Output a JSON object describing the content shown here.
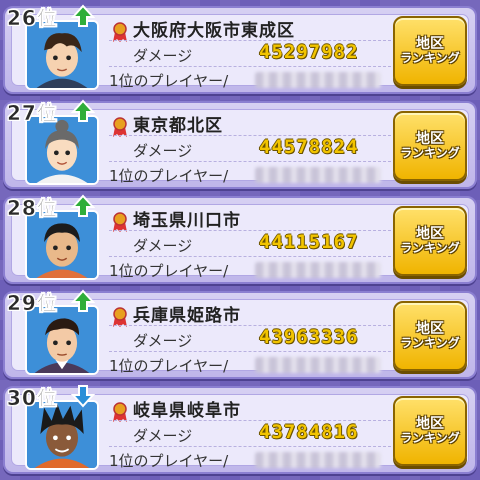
{
  "rows": [
    {
      "rank": "26位",
      "trend": "up",
      "area": "大阪府大阪市東成区",
      "damage_label": "ダメージ",
      "damage": "45297982",
      "player_label": "1位のプレイヤー/",
      "button_line1": "地区",
      "button_line2": "ランキング",
      "avatar": "boy-messy-hair"
    },
    {
      "rank": "27位",
      "trend": "up",
      "area": "東京都北区",
      "damage_label": "ダメージ",
      "damage": "44578824",
      "player_label": "1位のプレイヤー/",
      "button_line1": "地区",
      "button_line2": "ランキング",
      "avatar": "girl-bun"
    },
    {
      "rank": "28位",
      "trend": "up",
      "area": "埼玉県川口市",
      "damage_label": "ダメージ",
      "damage": "44115167",
      "player_label": "1位のプレイヤー/",
      "button_line1": "地区",
      "button_line2": "ランキング",
      "avatar": "boy-short-hair"
    },
    {
      "rank": "29位",
      "trend": "up",
      "area": "兵庫県姫路市",
      "damage_label": "ダメージ",
      "damage": "43963336",
      "player_label": "1位のプレイヤー/",
      "button_line1": "地区",
      "button_line2": "ランキング",
      "avatar": "man-slick-hair"
    },
    {
      "rank": "30位",
      "trend": "down",
      "area": "岐阜県岐阜市",
      "damage_label": "ダメージ",
      "damage": "43784816",
      "player_label": "1位のプレイヤー/",
      "button_line1": "地区",
      "button_line2": "ランキング",
      "avatar": "boy-dreadlocks"
    }
  ],
  "colors": {
    "up": "#2fae3a",
    "down": "#2a8fd8",
    "damage": "#f2c400",
    "button": "#f0b400"
  }
}
